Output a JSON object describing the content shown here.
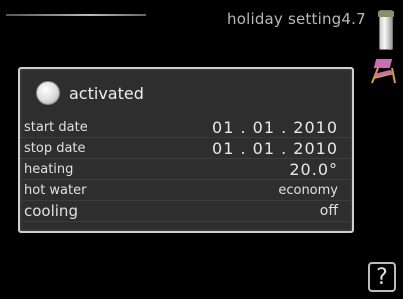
{
  "header": {
    "title": "holiday setting4.7"
  },
  "menu": {
    "activated_label": "activated",
    "rows": [
      {
        "label": "start date",
        "value": "01 . 01 . 2010"
      },
      {
        "label": "stop date",
        "value": "01 . 01 . 2010"
      },
      {
        "label": "heating",
        "value": "20.0°"
      },
      {
        "label": "hot water",
        "value": "economy"
      },
      {
        "label": "cooling",
        "value": "off"
      }
    ]
  },
  "help": {
    "label": "?"
  },
  "icons": {
    "scroll": "scroll-indicator-icon",
    "holiday": "deck-chair-icon",
    "help": "help-icon"
  }
}
